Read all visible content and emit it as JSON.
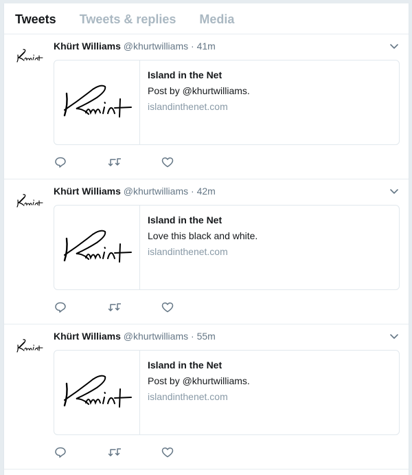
{
  "tabs": [
    "Tweets",
    "Tweets & replies",
    "Media"
  ],
  "icons": {
    "reply": "reply-icon",
    "retweet": "retweet-icon",
    "like": "heart-icon",
    "caret": "chevron-down-icon"
  },
  "colors": {
    "icon": "#657786",
    "muted": "#8899a6"
  },
  "tweets": [
    {
      "name": "Khürt Williams",
      "handle": "@khurtwilliams",
      "time": "41m",
      "card": {
        "title": "Island in the Net",
        "description": "Post by @khurtwilliams.",
        "domain": "islandinthenet.com"
      }
    },
    {
      "name": "Khürt Williams",
      "handle": "@khurtwilliams",
      "time": "42m",
      "card": {
        "title": "Island in the Net",
        "description": "Love this black and white.",
        "domain": "islandinthenet.com"
      }
    },
    {
      "name": "Khürt Williams",
      "handle": "@khurtwilliams",
      "time": "55m",
      "card": {
        "title": "Island in the Net",
        "description": "Post by @khurtwilliams.",
        "domain": "islandinthenet.com"
      }
    }
  ]
}
